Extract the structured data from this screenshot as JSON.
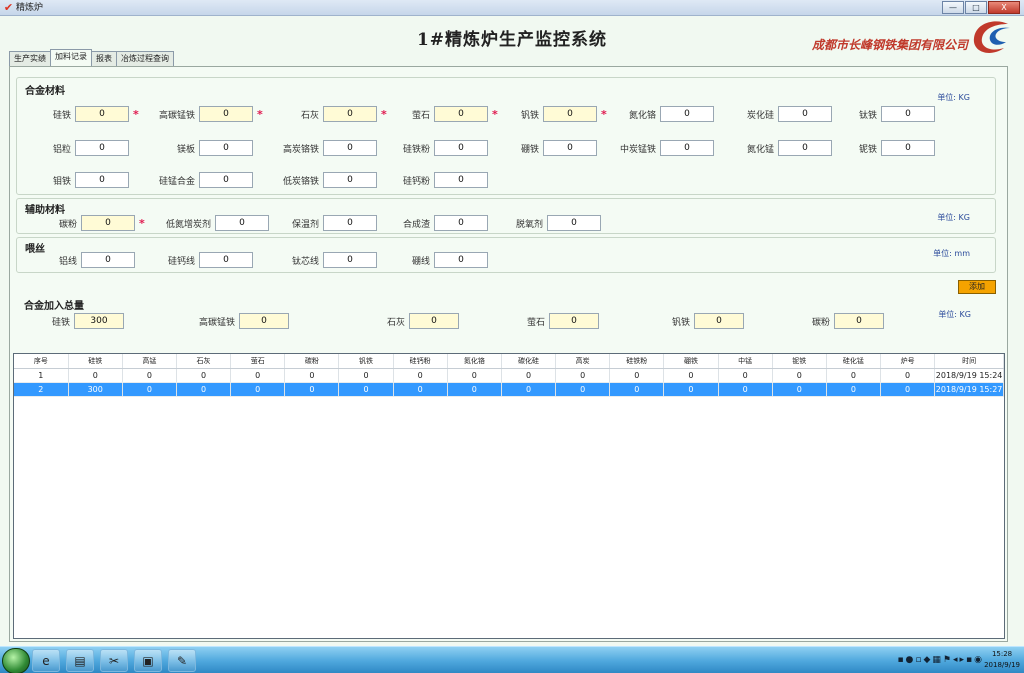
{
  "window": {
    "title": "精炼炉",
    "minimize": "—",
    "maximize": "□",
    "close": "X"
  },
  "header": {
    "system_title": "1#精炼炉生产监控系统",
    "company": "成都市长峰钢铁集团有限公司"
  },
  "tabs": [
    "生产实绩",
    "加料记录",
    "报表",
    "冶炼过程查询"
  ],
  "alloy": {
    "title": "合金材料",
    "unit": "单位: KG",
    "fields": [
      {
        "label": "硅铁",
        "value": "0",
        "required": true
      },
      {
        "label": "高碳锰铁",
        "value": "0",
        "required": true
      },
      {
        "label": "石灰",
        "value": "0",
        "required": true
      },
      {
        "label": "萤石",
        "value": "0",
        "required": true
      },
      {
        "label": "钒铁",
        "value": "0",
        "required": true
      },
      {
        "label": "氮化铬",
        "value": "0",
        "required": false
      },
      {
        "label": "炭化硅",
        "value": "0",
        "required": false
      },
      {
        "label": "钛铁",
        "value": "0",
        "required": false
      },
      {
        "label": "铝粒",
        "value": "0",
        "required": false
      },
      {
        "label": "镁板",
        "value": "0",
        "required": false
      },
      {
        "label": "高炭铬铁",
        "value": "0",
        "required": false
      },
      {
        "label": "硅铁粉",
        "value": "0",
        "required": false
      },
      {
        "label": "硼铁",
        "value": "0",
        "required": false
      },
      {
        "label": "中炭锰铁",
        "value": "0",
        "required": false
      },
      {
        "label": "氮化锰",
        "value": "0",
        "required": false
      },
      {
        "label": "铌铁",
        "value": "0",
        "required": false
      },
      {
        "label": "钼铁",
        "value": "0",
        "required": false
      },
      {
        "label": "硅锰合金",
        "value": "0",
        "required": false
      },
      {
        "label": "低炭铬铁",
        "value": "0",
        "required": false
      },
      {
        "label": "硅钙粉",
        "value": "0",
        "required": false
      }
    ]
  },
  "aux": {
    "title": "辅助材料",
    "unit": "单位: KG",
    "fields": [
      {
        "label": "碳粉",
        "value": "0",
        "required": true
      },
      {
        "label": "低氮增炭剂",
        "value": "0",
        "required": false
      },
      {
        "label": "保温剂",
        "value": "0",
        "required": false
      },
      {
        "label": "合成渣",
        "value": "0",
        "required": false
      },
      {
        "label": "脱氧剂",
        "value": "0",
        "required": false
      }
    ]
  },
  "wire": {
    "title": "喂丝",
    "unit": "单位: mm",
    "fields": [
      {
        "label": "铝线",
        "value": "0"
      },
      {
        "label": "硅钙线",
        "value": "0"
      },
      {
        "label": "钛芯线",
        "value": "0"
      },
      {
        "label": "硼线",
        "value": "0"
      }
    ]
  },
  "add_button": "添加",
  "total": {
    "title": "合金加入总量",
    "unit": "单位: KG",
    "fields": [
      {
        "label": "硅铁",
        "value": "300"
      },
      {
        "label": "高碳锰铁",
        "value": "0"
      },
      {
        "label": "石灰",
        "value": "0"
      },
      {
        "label": "萤石",
        "value": "0"
      },
      {
        "label": "钒铁",
        "value": "0"
      },
      {
        "label": "碳粉",
        "value": "0"
      }
    ]
  },
  "table": {
    "headers": [
      "序号",
      "硅铁",
      "高锰",
      "石灰",
      "萤石",
      "碳粉",
      "钒铁",
      "硅钙粉",
      "氮化铬",
      "碳化硅",
      "高炭",
      "硅铁粉",
      "硼铁",
      "中锰",
      "铌铁",
      "硅化锰",
      "炉号",
      "时间"
    ],
    "rows": [
      [
        "1",
        "0",
        "0",
        "0",
        "0",
        "0",
        "0",
        "0",
        "0",
        "0",
        "0",
        "0",
        "0",
        "0",
        "0",
        "0",
        "0",
        "2018/9/19 15:24"
      ],
      [
        "2",
        "300",
        "0",
        "0",
        "0",
        "0",
        "0",
        "0",
        "0",
        "0",
        "0",
        "0",
        "0",
        "0",
        "0",
        "0",
        "0",
        "2018/9/19 15:27"
      ]
    ],
    "selected_row": 1
  },
  "taskbar": {
    "icons": [
      "start-orb-icon",
      "ie-icon",
      "folder-icon",
      "tool-icon",
      "window-icon",
      "paint-icon"
    ],
    "clock_time": "15:28",
    "clock_date": "2018/9/19"
  }
}
